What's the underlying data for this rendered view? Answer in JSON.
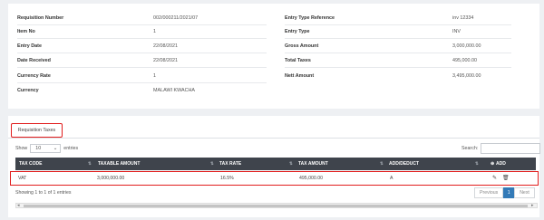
{
  "details": {
    "left": [
      {
        "label": "Requisition Number",
        "value": "002/000211/2021/07"
      },
      {
        "label": "Item No",
        "value": "1"
      },
      {
        "label": "Entry Date",
        "value": "22/08/2021"
      },
      {
        "label": "Date Received",
        "value": "22/08/2021"
      },
      {
        "label": "Currency Rate",
        "value": "1"
      },
      {
        "label": "Currency",
        "value": "MALAWI KWACHA"
      }
    ],
    "right": [
      {
        "label": "Entry Type Reference",
        "value": "inv 12334"
      },
      {
        "label": "Entry Type",
        "value": "INV"
      },
      {
        "label": "Gross Amount",
        "value": "3,000,000.00"
      },
      {
        "label": "Total Taxes",
        "value": "495,000.00"
      },
      {
        "label": "Nett Amount",
        "value": "3,495,000.00"
      }
    ]
  },
  "tabs": {
    "active": "Requisition Taxes"
  },
  "controls": {
    "show_label": "Show",
    "page_size": "10",
    "entries_label": "entries",
    "search_label": "Search:"
  },
  "table": {
    "headers": [
      "TAX CODE",
      "TAXABLE AMOUNT",
      "TAX RATE",
      "TAX AMOUNT",
      "ADD/DEDUCT",
      "ADD"
    ],
    "rows": [
      {
        "tax_code": "VAT",
        "taxable_amount": "3,000,000.00",
        "tax_rate": "16.5%",
        "tax_amount": "495,000.00",
        "add_deduct": "A"
      }
    ]
  },
  "footer": {
    "info": "Showing 1 to 1 of 1 entries",
    "previous": "Previous",
    "page": "1",
    "next": "Next"
  }
}
